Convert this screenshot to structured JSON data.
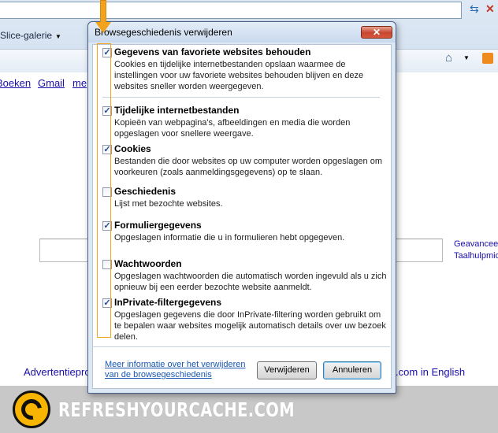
{
  "browser": {
    "slice_gallery": "Slice-galerie",
    "links": [
      "Boeken",
      "Gmail",
      "me"
    ],
    "advanced_search": "Geavancee",
    "language_tools": "Taalhulpmid",
    "advertising": "Advertentiepro",
    "com_english": ".com in English"
  },
  "dialog": {
    "title": "Browsegeschiedenis verwijderen",
    "close_label": "✕",
    "options": [
      {
        "title": "Gegevens van favoriete websites behouden",
        "checked": true,
        "description": "Cookies en tijdelijke internetbestanden opslaan waarmee de instellingen voor uw favoriete websites behouden blijven en deze websites sneller worden weergegeven."
      },
      {
        "title": "Tijdelijke internetbestanden",
        "checked": true,
        "description": "Kopieën van webpagina's, afbeeldingen en media die worden opgeslagen voor snellere weergave."
      },
      {
        "title": "Cookies",
        "checked": true,
        "description": "Bestanden die door websites op uw computer worden opgeslagen om voorkeuren (zoals aanmeldingsgegevens) op te slaan."
      },
      {
        "title": "Geschiedenis",
        "checked": false,
        "description": "Lijst met bezochte websites."
      },
      {
        "title": "Formuliergegevens",
        "checked": true,
        "description": "Opgeslagen informatie die u in formulieren hebt opgegeven."
      },
      {
        "title": "Wachtwoorden",
        "checked": false,
        "description": "Opgeslagen wachtwoorden die automatisch worden ingevuld als u zich opnieuw bij een eerder bezochte website aanmeldt."
      },
      {
        "title": "InPrivate-filtergegevens",
        "checked": true,
        "description": "Opgeslagen gegevens die door InPrivate-filtering worden gebruikt om te bepalen waar websites mogelijk automatisch details over uw bezoek delen."
      }
    ],
    "more_info_link": "Meer informatie over het verwijderen van de browsegeschiedenis",
    "delete_button": "Verwijderen",
    "cancel_button": "Annuleren"
  },
  "footer": {
    "brand": "REFRESHYOURCACHE.COM"
  },
  "colors": {
    "arrow": "#f3a21b",
    "dialog_bg": "#dde8f5",
    "close_button": "#c7462f",
    "link": "#1a0dab"
  }
}
